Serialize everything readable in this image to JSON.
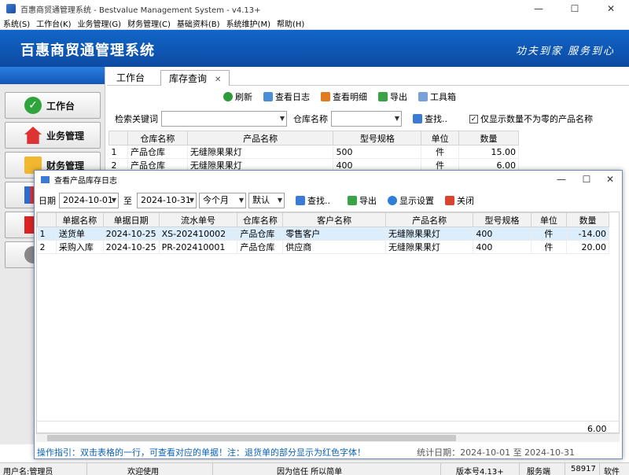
{
  "window": {
    "title": "百惠商贸通管理系统 - Bestvalue Management System - v4.13+",
    "minimize": "—",
    "maximize": "☐",
    "close": "✕"
  },
  "menu": [
    "系统(S)",
    "工作台(K)",
    "业务管理(G)",
    "财务管理(C)",
    "基础资料(B)",
    "系统维护(M)",
    "帮助(H)"
  ],
  "banner": {
    "title": "百惠商贸通管理系统",
    "slogan": "功夫到家 服务到心"
  },
  "sidebar": {
    "items": [
      {
        "label": "工作台",
        "icon": "check-icon"
      },
      {
        "label": "业务管理",
        "icon": "house-icon"
      },
      {
        "label": "财务管理",
        "icon": "folder-icon"
      }
    ]
  },
  "tabs": [
    {
      "label": "工作台"
    },
    {
      "label": "库存查询",
      "close": "✕"
    }
  ],
  "toolbar": {
    "refresh": "刷新",
    "view_log": "查看日志",
    "view_detail": "查看明细",
    "export": "导出",
    "toolbox": "工具箱"
  },
  "search": {
    "keyword_label": "检索关键词",
    "keyword_value": "",
    "warehouse_label": "仓库名称",
    "warehouse_value": "",
    "find_button": "查找..",
    "nonzero_checkbox_label": "仅显示数量不为零的产品名称",
    "nonzero_checked": true
  },
  "stock_table": {
    "columns": [
      "",
      "仓库名称",
      "产品名称",
      "型号规格",
      "单位",
      "数量"
    ],
    "rows": [
      [
        "1",
        "产品仓库",
        "无缝隙果果灯",
        "500",
        "件",
        "15.00"
      ],
      [
        "2",
        "产品仓库",
        "无缝隙果果灯",
        "400",
        "件",
        "6.00"
      ]
    ]
  },
  "dialog": {
    "title": "查看产品库存日志",
    "date_label": "日期",
    "date_from": "2024-10-01",
    "to_label": "至",
    "date_to": "2024-10-31",
    "period": "今个月",
    "order": "默认",
    "find_button": "查找..",
    "export_button": "导出",
    "display_settings": "显示设置",
    "close_button": "关闭",
    "columns": [
      "",
      "单据名称",
      "单据日期",
      "流水单号",
      "仓库名称",
      "客户名称",
      "产品名称",
      "型号规格",
      "单位",
      "数量"
    ],
    "rows": [
      [
        "1",
        "送货单",
        "2024-10-25",
        "XS-202410002",
        "产品仓库",
        "零售客户",
        "无缝隙果果灯",
        "400",
        "件",
        "-14.00"
      ],
      [
        "2",
        "采购入库",
        "2024-10-25",
        "PR-202410001",
        "产品仓库",
        "供应商",
        "无缝隙果果灯",
        "400",
        "件",
        "20.00"
      ]
    ],
    "total": "6.00",
    "hint": "操作指引：双击表格的一行，可查看对应的单据！注：退货单的部分显示为红色字体！",
    "stat_date": "统计日期：2024-10-01 至 2024-10-31"
  },
  "status": {
    "user": "用户名:管理员",
    "welcome": "欢迎使用",
    "motto": "因为信任 所以简单",
    "version": "版本号4.13+",
    "service": "服务端",
    "port": "58917",
    "software": "软件"
  },
  "colors": {
    "banner": "#0b4aa3",
    "hint": "#0a62b8",
    "selected_row": "#dceefc"
  }
}
